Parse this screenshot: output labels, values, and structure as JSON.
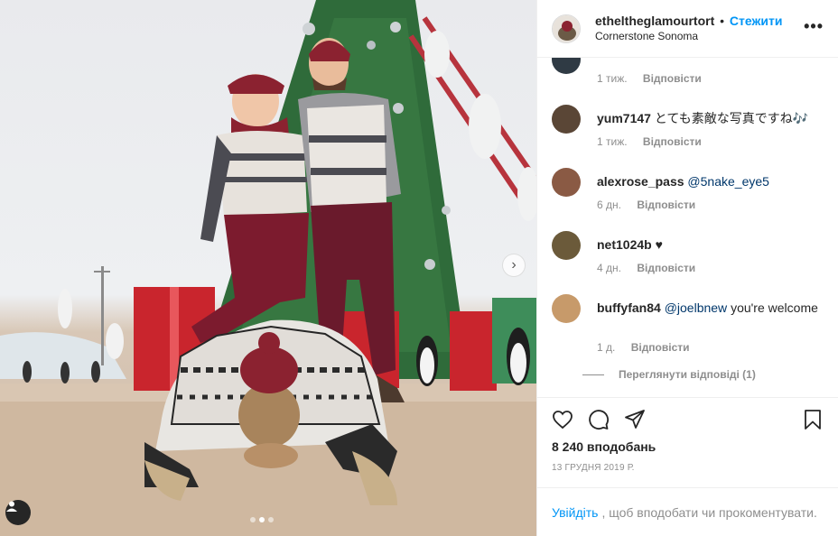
{
  "post": {
    "author": "etheltheglamourtort",
    "separator": "•",
    "follow_label": "Стежити",
    "location": "Cornerstone Sonoma",
    "more_label": "•••"
  },
  "comments": [
    {
      "username": "",
      "text": "",
      "age": "1 тиж.",
      "reply_label": "Відповісти",
      "avatar_color": "#2f3a44"
    },
    {
      "username": "yum7147",
      "text": "とても素敵な写真ですね🎶",
      "age": "1 тиж.",
      "reply_label": "Відповісти",
      "avatar_color": "#5a4636"
    },
    {
      "username": "alexrose_pass",
      "mention": "@5nake_eye5",
      "text": "",
      "age": "6 дн.",
      "reply_label": "Відповісти",
      "avatar_color": "#8a5a44"
    },
    {
      "username": "net1024b",
      "text": "♥",
      "age": "4 дн.",
      "reply_label": "Відповісти",
      "avatar_color": "#6b5a3a"
    },
    {
      "username": "buffyfan84",
      "mention": "@joelbnew",
      "text": "you're welcome",
      "age": "1 д.",
      "reply_label": "Відповісти",
      "avatar_color": "#c79a6a"
    }
  ],
  "view_replies_label": "Переглянути відповіді (1)",
  "likes": "8 240 вподобань",
  "date": "13 ГРУДНЯ 2019 Р.",
  "login": {
    "link": "Увійдіть",
    "text": ", щоб вподобати чи прокоментувати."
  },
  "carousel": {
    "slide_count": 3,
    "active_index": 1
  },
  "icons": [
    "heart-icon",
    "comment-icon",
    "share-icon",
    "save-icon",
    "chevron-right-icon",
    "user-tag-icon"
  ],
  "colors": {
    "accent": "#0095f6",
    "text": "#262626",
    "muted": "#8e8e8e",
    "border": "#efefef"
  }
}
